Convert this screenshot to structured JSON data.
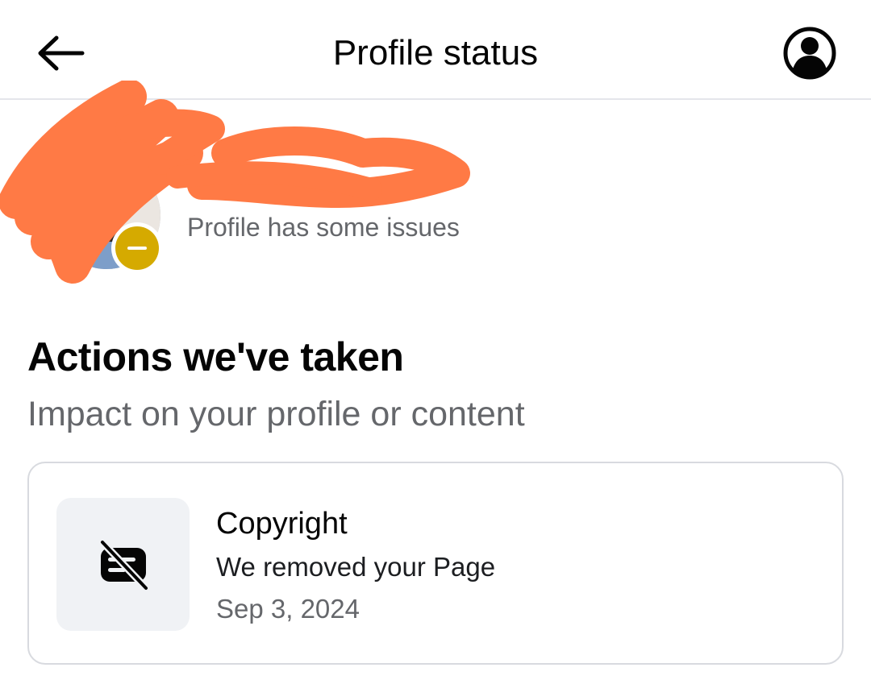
{
  "header": {
    "title": "Profile status",
    "back_icon": "arrow-left-icon",
    "account_icon": "account-circle-icon"
  },
  "profile": {
    "status_text": "Profile has some issues",
    "status_badge_color": "#d5aa00",
    "redaction_color": "#ff7a45"
  },
  "actions_section": {
    "title": "Actions we've taken",
    "subtitle": "Impact on your profile or content",
    "items": [
      {
        "icon": "page-removed-icon",
        "title": "Copyright",
        "description": "We removed your Page",
        "date": "Sep 3, 2024"
      }
    ]
  }
}
